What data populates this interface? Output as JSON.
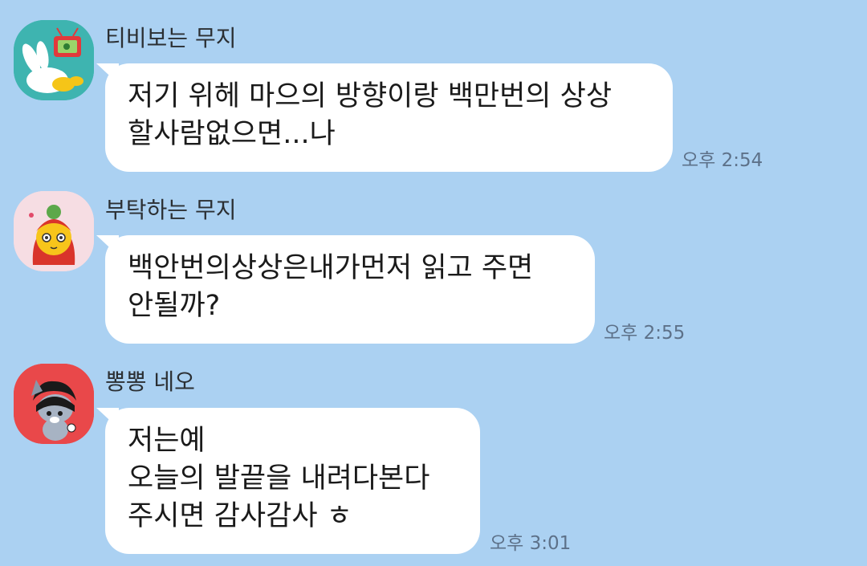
{
  "colors": {
    "chat_background": "#abd1f2",
    "bubble": "#ffffff",
    "timestamp": "#5d7189"
  },
  "messages": [
    {
      "sender": "티비보는 무지",
      "avatar_icon": "muzi-watching-tv-avatar-icon",
      "avatar_color": "#3eb4b0",
      "lines": [
        "저기 위헤 마으의 방향이랑 백만번의 상상",
        "할사람없으면...나"
      ],
      "time": "오후 2:54"
    },
    {
      "sender": "부탁하는 무지",
      "avatar_icon": "muzi-asking-avatar-icon",
      "avatar_color": "#f6dde3",
      "lines": [
        "백안번의상상은내가먼저 읽고 주면",
        "안될까?"
      ],
      "time": "오후 2:55"
    },
    {
      "sender": "뽕뽕 네오",
      "avatar_icon": "neo-avatar-icon",
      "avatar_color": "#e9484a",
      "lines": [
        "저는예",
        "오늘의 발끝을 내려다본다",
        "주시면 감사감사 ㅎ"
      ],
      "time": "오후 3:01"
    }
  ]
}
